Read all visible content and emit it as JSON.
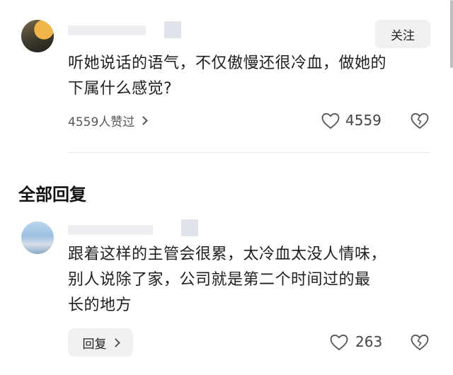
{
  "main_comment": {
    "follow_label": "关注",
    "text_line1": "听她说话的语气，不仅傲慢还很冷血，做她的",
    "text_line2": "下属什么感觉?",
    "liked_by": "4559人赞过",
    "like_count": "4559"
  },
  "replies_section": {
    "title": "全部回复"
  },
  "reply": {
    "text_line1": "跟着这样的主管会很累，太冷血太没人情味，",
    "text_line2": "别人说除了家，公司就是第二个时间过的最",
    "text_line3": "长的地方",
    "reply_label": "回复",
    "like_count": "263"
  }
}
